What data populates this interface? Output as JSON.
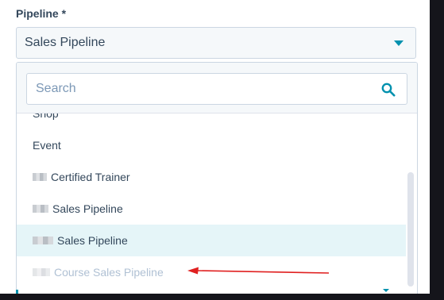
{
  "field": {
    "label": "Pipeline *",
    "selected_value": "Sales Pipeline"
  },
  "search": {
    "placeholder": "Search"
  },
  "options": [
    {
      "label": "Shop",
      "redacted_prefix": false,
      "state": "partial"
    },
    {
      "label": "Event",
      "redacted_prefix": false,
      "state": "normal"
    },
    {
      "label": "Certified Trainer",
      "redacted_prefix": true,
      "state": "normal"
    },
    {
      "label": "Sales Pipeline",
      "redacted_prefix": true,
      "state": "normal"
    },
    {
      "label": "Sales Pipeline",
      "redacted_prefix": true,
      "state": "highlighted"
    },
    {
      "label": "Course Sales Pipeline",
      "redacted_prefix": true,
      "state": "disabled"
    }
  ],
  "colors": {
    "accent": "#0091ae",
    "highlight": "#e5f5f8",
    "annotation_arrow": "#e02020"
  },
  "icons": {
    "search": "search-icon",
    "caret": "chevron-down-icon"
  }
}
